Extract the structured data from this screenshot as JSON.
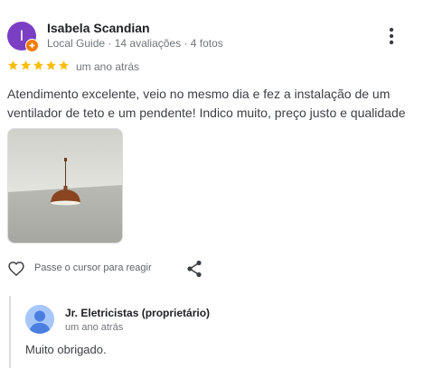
{
  "reviewer": {
    "initial": "I",
    "name": "Isabela Scandian",
    "meta": "Local Guide · 14 avaliações · 4 fotos"
  },
  "review": {
    "rating": 5,
    "time": "um ano atrás",
    "text": "Atendimento excelente, veio no mesmo dia e fez a instalação de um ventilador de teto e um pendente! Indico muito, preço justo e qualidade"
  },
  "actions": {
    "react_hint": "Passe o cursor para reagir"
  },
  "reply": {
    "owner_name": "Jr. Eletricistas (proprietário)",
    "time": "um ano atrás",
    "text": "Muito obrigado."
  },
  "colors": {
    "avatar": "#7b3fc4",
    "badge": "#f57c00",
    "star": "#fbbc04",
    "owner_avatar": "#a7c7fa"
  },
  "icons": [
    "more-vert-icon",
    "star-icon",
    "heart-outline-icon",
    "share-icon",
    "person-icon",
    "local-guide-badge-icon"
  ]
}
